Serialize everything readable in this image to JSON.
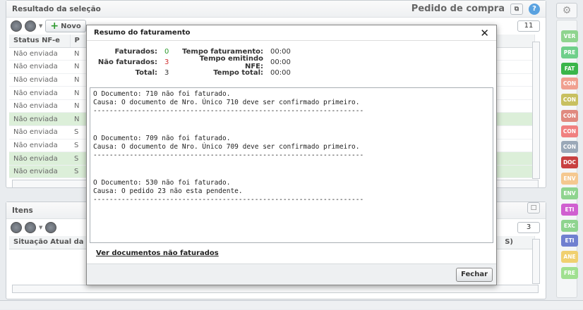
{
  "top_panel": {
    "header": "Resultado da seleção",
    "title_right": "Pedido de compra",
    "new_button": "Novo",
    "columns": [
      "Status NF-e",
      "P"
    ],
    "rows": [
      {
        "status": "Não enviada",
        "p": "N",
        "selected": false
      },
      {
        "status": "Não enviada",
        "p": "N",
        "selected": false
      },
      {
        "status": "Não enviada",
        "p": "N",
        "selected": false
      },
      {
        "status": "Não enviada",
        "p": "N",
        "selected": false
      },
      {
        "status": "Não enviada",
        "p": "N",
        "selected": false
      },
      {
        "status": "Não enviada",
        "p": "N",
        "selected": true
      },
      {
        "status": "Não enviada",
        "p": "S",
        "selected": false
      },
      {
        "status": "Não enviada",
        "p": "S",
        "selected": false
      },
      {
        "status": "Não enviada",
        "p": "S",
        "selected": true
      },
      {
        "status": "Não enviada",
        "p": "S",
        "selected": true
      }
    ],
    "count": "11"
  },
  "bottom_panel": {
    "header": "Itens",
    "count": "3",
    "column": "Situação Atual da P",
    "column_right": "S)"
  },
  "side_tags": [
    {
      "label": "VER",
      "color": "#8fd48f"
    },
    {
      "label": "PRE",
      "color": "#6fcf8a"
    },
    {
      "label": "FAT",
      "color": "#3ab54a"
    },
    {
      "label": "CON",
      "color": "#f0a090"
    },
    {
      "label": "CON",
      "color": "#c8c060"
    },
    {
      "label": "CON",
      "color": "#e08a80"
    },
    {
      "label": "CON",
      "color": "#f08080"
    },
    {
      "label": "CON",
      "color": "#9aa8b8"
    },
    {
      "label": "DOC",
      "color": "#c84040"
    },
    {
      "label": "ENV",
      "color": "#f5c890"
    },
    {
      "label": "ENV",
      "color": "#8fd48f"
    },
    {
      "label": "ETI",
      "color": "#d060d0"
    },
    {
      "label": "EXC",
      "color": "#8fd48f"
    },
    {
      "label": "ETI",
      "color": "#7080d0"
    },
    {
      "label": "ANE",
      "color": "#f0d070"
    },
    {
      "label": "FRE",
      "color": "#a0e090"
    }
  ],
  "dialog": {
    "title": "Resumo do faturamento",
    "stats": {
      "faturados_label": "Faturados:",
      "faturados_value": "0",
      "tempo_fat_label": "Tempo faturamento:",
      "tempo_fat_value": "00:00",
      "nao_fat_label": "Não faturados:",
      "nao_fat_value": "3",
      "tempo_nfe_label": "Tempo emitindo NFE:",
      "tempo_nfe_value": "00:00",
      "total_label": "Total:",
      "total_value": "3",
      "tempo_total_label": "Tempo total:",
      "tempo_total_value": "00:00"
    },
    "messages": [
      "O Documento: 710 não foi faturado.\nCausa: O documento de Nro. Único 710 deve ser confirmado primeiro.\n-------------------------------------------------------------------",
      "O Documento: 709 não foi faturado.\nCausa: O documento de Nro. Único 709 deve ser confirmado primeiro.\n-------------------------------------------------------------------",
      "O Documento: 530 não foi faturado.\nCausa: O pedido 23 não esta pendente.\n-------------------------------------------------------------------"
    ],
    "link": "Ver documentos não faturados",
    "close_button": "Fechar"
  }
}
